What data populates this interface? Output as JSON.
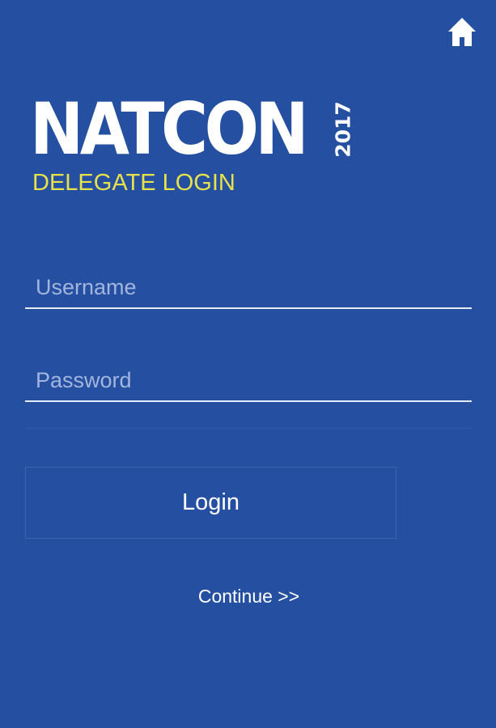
{
  "header": {
    "home_icon": "home-icon"
  },
  "logo": {
    "word": "NATCON",
    "year": "2017"
  },
  "subtitle": "DELEGATE LOGIN",
  "form": {
    "username": {
      "placeholder": "Username",
      "value": ""
    },
    "password": {
      "placeholder": "Password",
      "value": ""
    },
    "login_label": "Login",
    "continue_label": "Continue >>"
  },
  "colors": {
    "background": "#2550a2",
    "subtitle": "#e8e24a",
    "text": "#ffffff",
    "placeholder": "#a3b5dc"
  }
}
